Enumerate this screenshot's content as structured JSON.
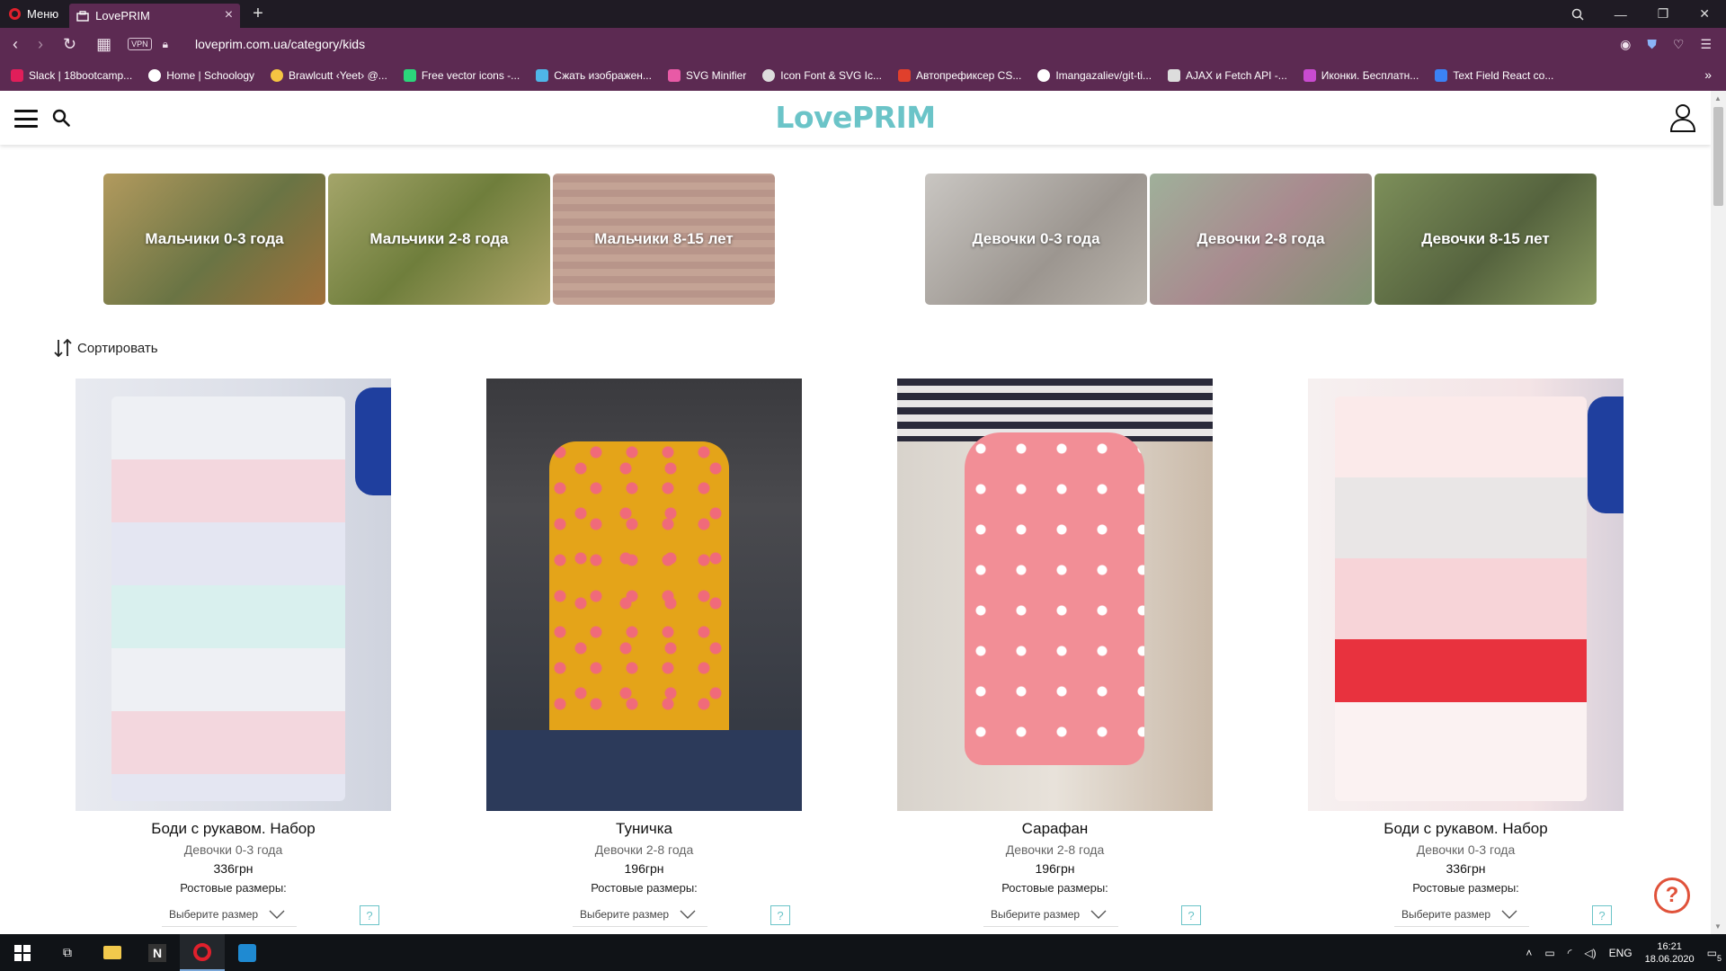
{
  "browser": {
    "menu_label": "Меню",
    "tab_title": "LovePRIM",
    "new_tab_symbol": "+",
    "close_symbol": "×",
    "vpn_label": "VPN",
    "url": "loveprim.com.ua/category/kids",
    "bookmarks": [
      {
        "label": "Slack | 18bootcamp...",
        "color": "#e01e5a"
      },
      {
        "label": "Home | Schoology",
        "color": "#ffffff"
      },
      {
        "label": "Brawlcutt ‹Yeet› @...",
        "color": "#f5c542"
      },
      {
        "label": "Free vector icons -...",
        "color": "#2bd67b"
      },
      {
        "label": "Сжать изображен...",
        "color": "#4fb6e8"
      },
      {
        "label": "SVG Minifier",
        "color": "#e85aa6"
      },
      {
        "label": "Icon Font & SVG Ic...",
        "color": "#dddddd"
      },
      {
        "label": "Автопрефиксер CS...",
        "color": "#e0402c"
      },
      {
        "label": "Imangazaliev/git-ti...",
        "color": "#ffffff"
      },
      {
        "label": "AJAX и Fetch API -...",
        "color": "#dddddd"
      },
      {
        "label": "Иконки. Бесплатн...",
        "color": "#c94bd0"
      },
      {
        "label": "Text Field React co...",
        "color": "#3b82f6"
      }
    ],
    "bookmarks_more": "»"
  },
  "site": {
    "logo": "LovePRIM",
    "sort_label": "Сортировать",
    "brand_color": "#6bc4c8"
  },
  "categories": [
    {
      "label": "Мальчики 0-3 года",
      "color": "#8a7a45"
    },
    {
      "label": "Мальчики 2-8 года",
      "color": "#8c8f54"
    },
    {
      "label": "Мальчики 8-15 лет",
      "color": "#a5897a"
    },
    {
      "label": "Девочки 0-3 года",
      "color": "#a8a39c"
    },
    {
      "label": "Девочки 2-8 года",
      "color": "#8a9a86"
    },
    {
      "label": "Девочки 8-15 лет",
      "color": "#6f7f55"
    }
  ],
  "products": [
    {
      "title": "Боди с рукавом. Набор",
      "category": "Девочки 0-3 года",
      "price": "336грн",
      "sizes_label": "Ростовые размеры:",
      "size_placeholder": "Выберите размер",
      "help": "?",
      "photo_color": "#dfe2ea"
    },
    {
      "title": "Туничка",
      "category": "Девочки 2-8 года",
      "price": "196грн",
      "sizes_label": "Ростовые размеры:",
      "size_placeholder": "Выберите размер",
      "help": "?",
      "photo_color": "#e0a51e"
    },
    {
      "title": "Сарафан",
      "category": "Девочки 2-8 года",
      "price": "196грн",
      "sizes_label": "Ростовые размеры:",
      "size_placeholder": "Выберите размер",
      "help": "?",
      "photo_color": "#f0949c"
    },
    {
      "title": "Боди с рукавом. Набор",
      "category": "Девочки 0-3 года",
      "price": "336грн",
      "sizes_label": "Ростовые размеры:",
      "size_placeholder": "Выберите размер",
      "help": "?",
      "photo_color": "#f3d6d8"
    }
  ],
  "help_button": "?",
  "taskbar": {
    "lang": "ENG",
    "time": "16:21",
    "date": "18.06.2020",
    "notifications": "5"
  }
}
